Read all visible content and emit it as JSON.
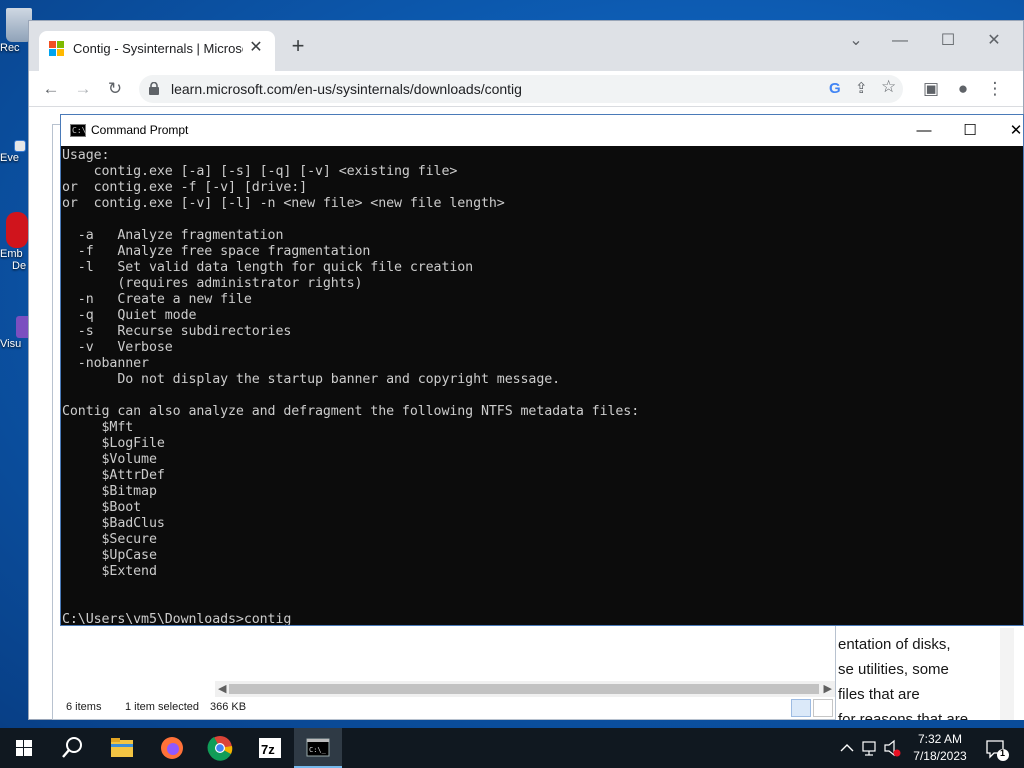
{
  "desktop": {
    "icons": [
      {
        "label": "Rec",
        "name": "recycle-bin"
      },
      {
        "label": "Eve",
        "name": "event-viewer"
      },
      {
        "label": "Emb",
        "name": "embarcadero"
      },
      {
        "label": "De",
        "name": "embarcadero-2"
      },
      {
        "label": "Visu",
        "name": "visual-studio"
      }
    ]
  },
  "browser": {
    "tab_title": "Contig - Sysinternals | Microsoft",
    "url": "learn.microsoft.com/en-us/sysinternals/downloads/contig",
    "favicon_colors": [
      "#f25022",
      "#7fba00",
      "#00a4ef",
      "#ffb900"
    ]
  },
  "explorer": {
    "items_count": "6 items",
    "selection": "1 item selected",
    "selection_size": "366 KB"
  },
  "webpage": {
    "fragments": [
      "entation of disks,",
      "se utilities, some",
      "files that are",
      "for reasons that are"
    ]
  },
  "cmd": {
    "title": "Command Prompt",
    "lines": [
      "Usage:",
      "    contig.exe [-a] [-s] [-q] [-v] <existing file>",
      "or  contig.exe -f [-v] [drive:]",
      "or  contig.exe [-v] [-l] -n <new file> <new file length>",
      "",
      "  -a   Analyze fragmentation",
      "  -f   Analyze free space fragmentation",
      "  -l   Set valid data length for quick file creation",
      "       (requires administrator rights)",
      "  -n   Create a new file",
      "  -q   Quiet mode",
      "  -s   Recurse subdirectories",
      "  -v   Verbose",
      "  -nobanner",
      "       Do not display the startup banner and copyright message.",
      "",
      "Contig can also analyze and defragment the following NTFS metadata files:",
      "     $Mft",
      "     $LogFile",
      "     $Volume",
      "     $AttrDef",
      "     $Bitmap",
      "     $Boot",
      "     $BadClus",
      "     $Secure",
      "     $UpCase",
      "     $Extend",
      "",
      "",
      "C:\\Users\\vm5\\Downloads>contig"
    ]
  },
  "taskbar": {
    "time": "7:32 AM",
    "date": "7/18/2023",
    "notification_count": "1",
    "apps": [
      "start",
      "search",
      "file-explorer",
      "firefox",
      "chrome",
      "7zip",
      "command-prompt"
    ]
  }
}
